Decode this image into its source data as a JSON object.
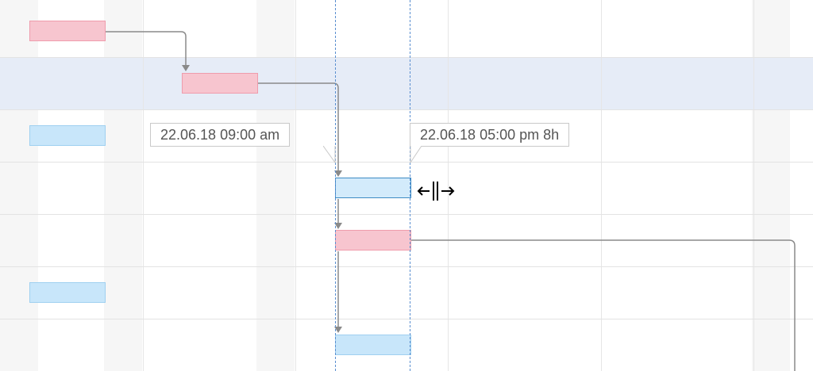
{
  "tooltips": {
    "start": "22.06.18 09:00 am",
    "end": "22.06.18 05:00 pm 8h"
  },
  "colors": {
    "task_fill": "#f7c5cf",
    "task_border": "#ef9cac",
    "milestone_fill": "#c8e6fa",
    "selected_border": "#3d8bc4",
    "highlight_row": "#e6ecf7",
    "link_line": "#8a8a8a",
    "guide_line": "#5a8fd0"
  },
  "icons": {
    "resize_cursor": "resize-horizontal-icon",
    "link_arrow": "arrow-down-icon"
  }
}
